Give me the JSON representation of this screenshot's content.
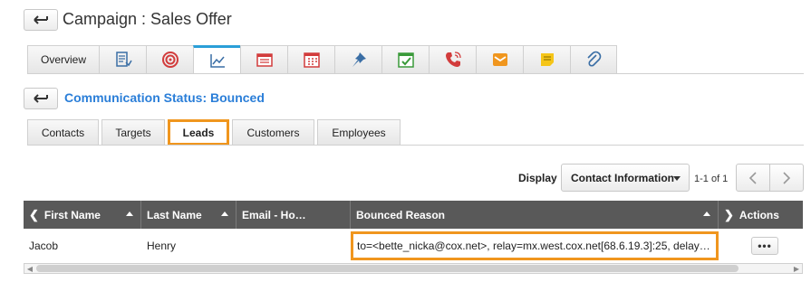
{
  "page": {
    "title": "Campaign : Sales Offer"
  },
  "module_tabs": [
    {
      "label": "Overview",
      "icon": "overview"
    },
    {
      "icon": "notes-icon"
    },
    {
      "icon": "target-icon"
    },
    {
      "icon": "chart-icon",
      "active": true
    },
    {
      "icon": "calendar-list-icon"
    },
    {
      "icon": "calendar-icon"
    },
    {
      "icon": "pin-icon"
    },
    {
      "icon": "task-icon"
    },
    {
      "icon": "call-icon"
    },
    {
      "icon": "mail-icon"
    },
    {
      "icon": "sticky-note-icon"
    },
    {
      "icon": "attachment-icon"
    }
  ],
  "communication": {
    "title": "Communication Status: Bounced"
  },
  "sub_tabs": [
    {
      "label": "Contacts"
    },
    {
      "label": "Targets"
    },
    {
      "label": "Leads",
      "active": true
    },
    {
      "label": "Customers"
    },
    {
      "label": "Employees"
    }
  ],
  "display": {
    "label": "Display",
    "selected": "Contact Information",
    "count": "1-1 of 1"
  },
  "table": {
    "columns": [
      "First Name",
      "Last Name",
      "Email - Ho…",
      "Bounced Reason",
      "Actions"
    ],
    "rows": [
      {
        "first_name": "Jacob",
        "last_name": "Henry",
        "email": "",
        "bounced_reason": "to=<bette_nicka@cox.net>, relay=mx.west.cox.net[68.6.19.3]:25, delay…",
        "actions": "•••"
      }
    ]
  },
  "colors": {
    "accent": "#2a9fd8",
    "title_blue": "#2a7ed8",
    "highlight_orange": "#f0961e",
    "header_dark": "#595959"
  }
}
